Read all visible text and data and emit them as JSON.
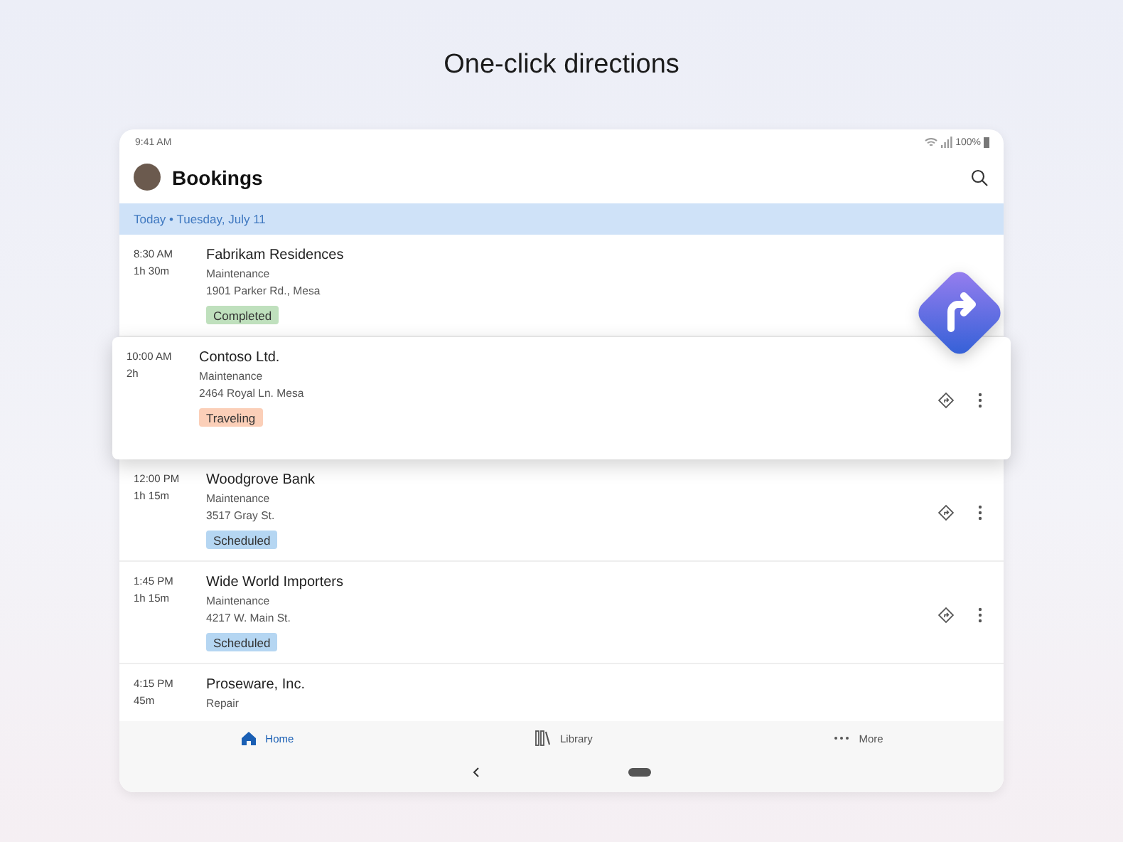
{
  "headline": "One-click directions",
  "status_bar": {
    "time": "9:41 AM",
    "battery": "100%"
  },
  "header": {
    "title": "Bookings"
  },
  "date_bar": {
    "day": "Today",
    "separator": "•",
    "date": "Tuesday, July 11"
  },
  "bookings": [
    {
      "time": "8:30 AM",
      "duration": "1h 30m",
      "title": "Fabrikam Residences",
      "category": "Maintenance",
      "address": "1901 Parker Rd., Mesa",
      "status": "Completed",
      "color": "#bfe0bd",
      "raised": false,
      "actions": false
    },
    {
      "time": "10:00 AM",
      "duration": "2h",
      "title": "Contoso Ltd.",
      "category": "Maintenance",
      "address": "2464 Royal Ln. Mesa",
      "status": "Traveling",
      "color": "#fbcfb8",
      "raised": true,
      "actions": true
    },
    {
      "time": "12:00 PM",
      "duration": "1h 15m",
      "title": "Woodgrove Bank",
      "category": "Maintenance",
      "address": "3517 Gray St.",
      "status": "Scheduled",
      "color": "#b5d6f2",
      "raised": false,
      "actions": true
    },
    {
      "time": "1:45 PM",
      "duration": "1h 15m",
      "title": "Wide World Importers",
      "category": "Maintenance",
      "address": "4217 W. Main St.",
      "status": "Scheduled",
      "color": "#b5d6f2",
      "raised": false,
      "actions": true
    },
    {
      "time": "4:15 PM",
      "duration": "45m",
      "title": "Proseware, Inc.",
      "category": "Repair",
      "raised": false,
      "actions": false
    }
  ],
  "nav": [
    {
      "label": "Home",
      "kind": "home",
      "selected": true
    },
    {
      "label": "Library",
      "kind": "library",
      "selected": false
    },
    {
      "label": "More",
      "kind": "more",
      "selected": false
    }
  ]
}
